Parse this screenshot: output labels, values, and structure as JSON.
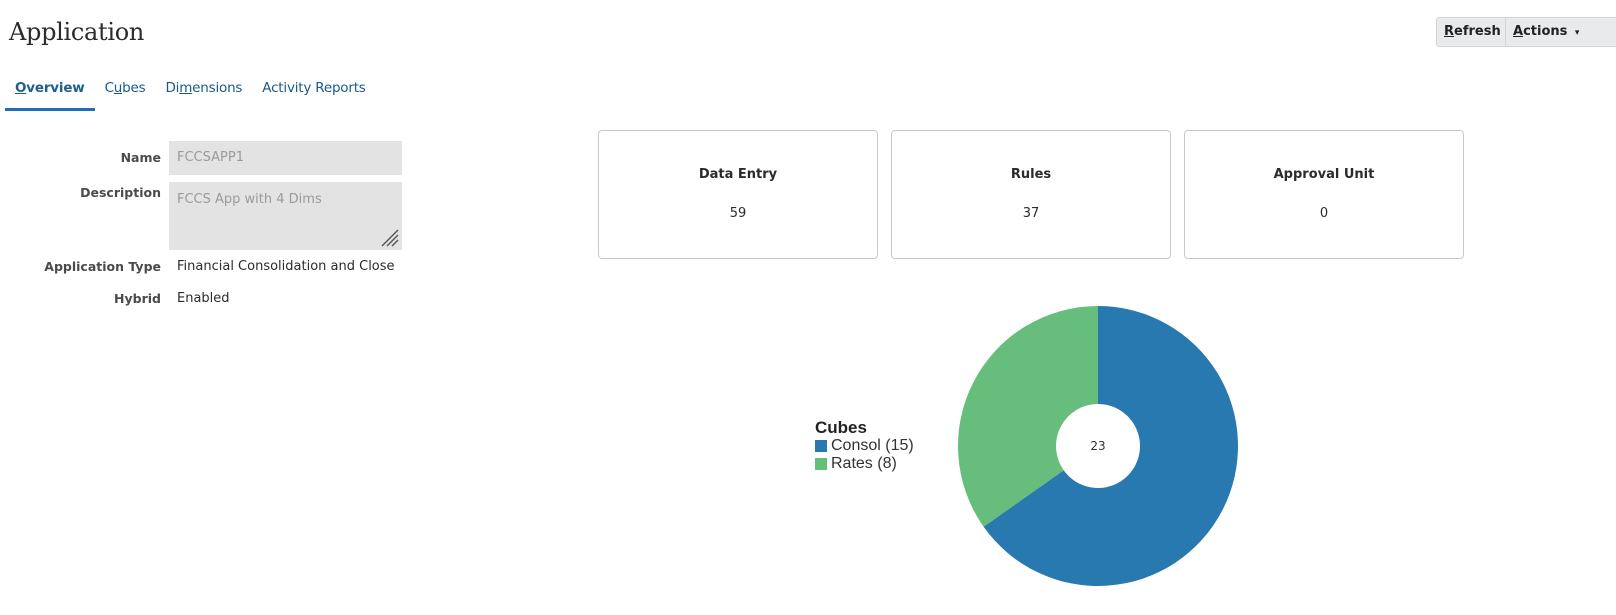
{
  "header": {
    "title": "Application",
    "buttons": [
      {
        "label": "Refresh",
        "accesskey": "R",
        "rest": "efresh"
      },
      {
        "label": "Actions",
        "accesskey": "A",
        "rest": "ctions"
      }
    ]
  },
  "tabs": [
    {
      "label": "Overview",
      "pre": "",
      "acc": "O",
      "post": "verview",
      "active": true
    },
    {
      "label": "Cubes",
      "pre": "C",
      "acc": "u",
      "post": "bes",
      "active": false
    },
    {
      "label": "Dimensions",
      "pre": "Di",
      "acc": "m",
      "post": "ensions",
      "active": false
    },
    {
      "label": "Activity Reports",
      "pre": "Activity Reports",
      "acc": "",
      "post": "",
      "active": false
    }
  ],
  "form": {
    "name_label": "Name",
    "name_value": "FCCSAPP1",
    "description_label": "Description",
    "description_value": "FCCS App with 4 Dims",
    "app_type_label": "Application Type",
    "app_type_value": "Financial Consolidation and Close",
    "hybrid_label": "Hybrid",
    "hybrid_value": "Enabled"
  },
  "cards": [
    {
      "title": "Data Entry",
      "value": "59"
    },
    {
      "title": "Rules",
      "value": "37"
    },
    {
      "title": "Approval Unit",
      "value": "0"
    }
  ],
  "colors": {
    "accent": "#1e6fb5",
    "tab_text": "#175a8c",
    "consol": "#2779b0",
    "rates": "#66bd7c"
  },
  "chart_data": {
    "type": "pie",
    "variant": "donut",
    "title": "Cubes",
    "center_label": "23",
    "categories": [
      "Consol",
      "Rates"
    ],
    "values": [
      15,
      8
    ],
    "legend_labels": [
      "Consol (15)",
      "Rates (8)"
    ],
    "colors": [
      "#2779b0",
      "#66bd7c"
    ],
    "legend_position": "left",
    "start_angle": "12 o'clock",
    "direction": "clockwise"
  }
}
